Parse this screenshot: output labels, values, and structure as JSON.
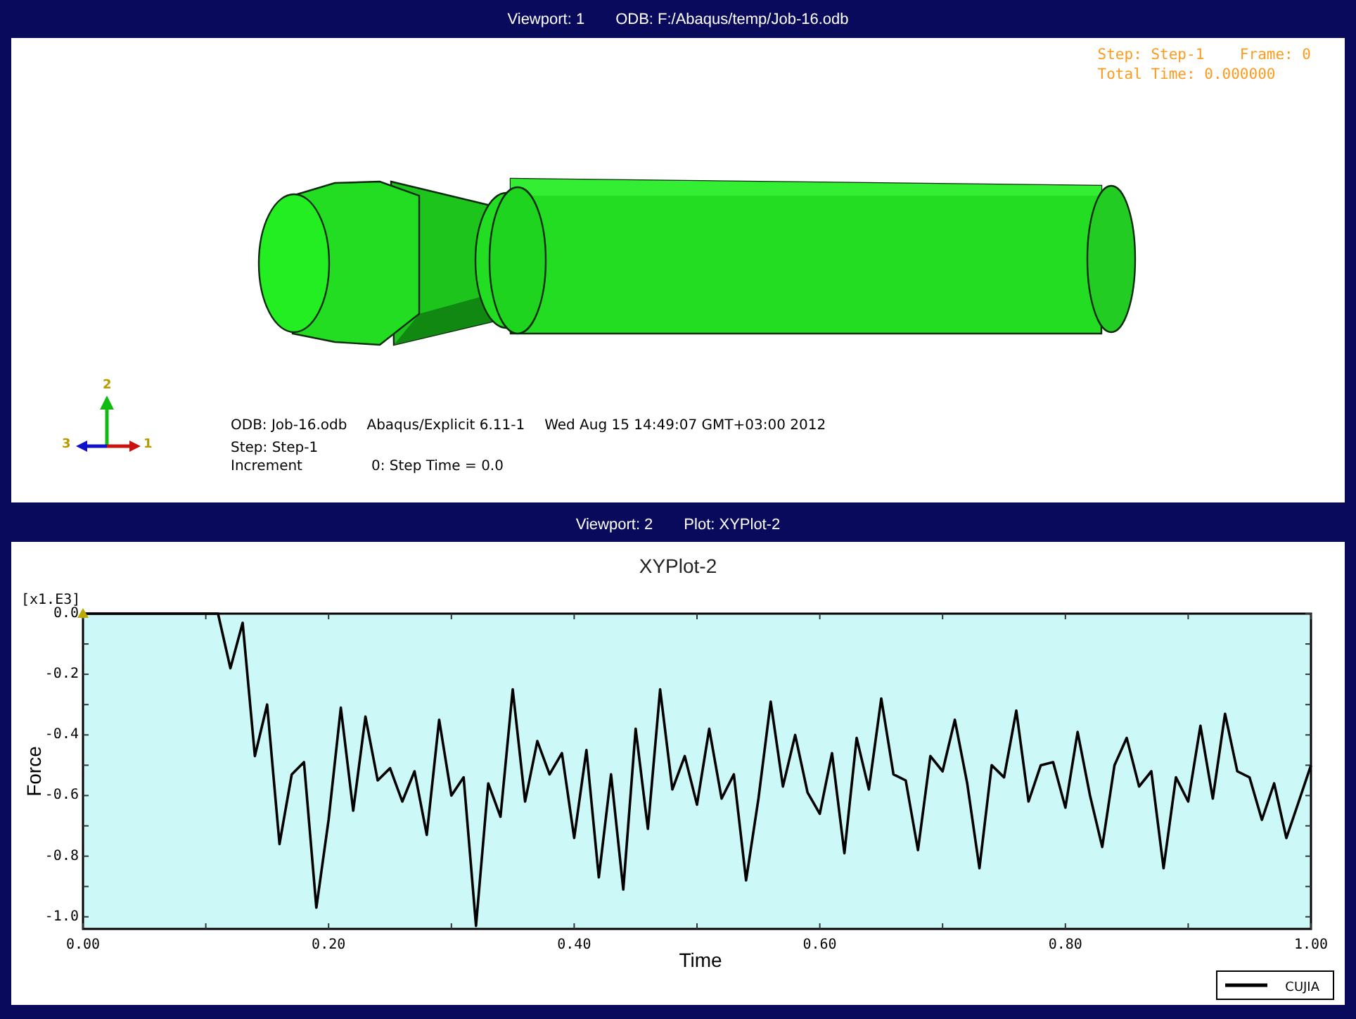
{
  "viewport_1": {
    "title_label": "Viewport: 1",
    "title_odb": "ODB: F:/Abaqus/temp/Job-16.odb",
    "state_lines": [
      "Step: Step-1    Frame: 0",
      "Total Time: 0.000000"
    ],
    "triad": {
      "axis_labels": [
        "1",
        "2",
        "3"
      ]
    },
    "info": {
      "odb": "ODB: Job-16.odb",
      "solver": "Abaqus/Explicit 6.11-1",
      "date": "Wed Aug 15 14:49:07 GMT+03:00 2012",
      "step": "Step: Step-1",
      "increment_label": "Increment",
      "increment_value": "0: Step Time = 0.0"
    }
  },
  "viewport_2": {
    "title_label": "Viewport: 2",
    "title_plot": "Plot: XYPlot-2",
    "y_scale": "[x1.E3]",
    "chart_data": {
      "type": "line",
      "title": "XYPlot-2",
      "xlabel": "Time",
      "ylabel": "Force",
      "x": [
        0,
        0.01,
        0.02,
        0.03,
        0.04,
        0.05,
        0.06,
        0.07,
        0.08,
        0.09,
        0.1,
        0.11,
        0.12,
        0.13,
        0.14,
        0.15,
        0.16,
        0.17,
        0.18,
        0.19,
        0.2,
        0.21,
        0.22,
        0.23,
        0.24,
        0.25,
        0.26,
        0.27,
        0.28,
        0.29,
        0.3,
        0.31,
        0.32,
        0.33,
        0.34,
        0.35,
        0.36,
        0.37,
        0.38,
        0.39,
        0.4,
        0.41,
        0.42,
        0.43,
        0.44,
        0.45,
        0.46,
        0.47,
        0.48,
        0.49,
        0.5,
        0.51,
        0.52,
        0.53,
        0.54,
        0.55,
        0.56,
        0.57,
        0.58,
        0.59,
        0.6,
        0.61,
        0.62,
        0.63,
        0.64,
        0.65,
        0.66,
        0.67,
        0.68,
        0.69,
        0.7,
        0.71,
        0.72,
        0.73,
        0.74,
        0.75,
        0.76,
        0.77,
        0.78,
        0.79,
        0.8,
        0.81,
        0.82,
        0.83,
        0.84,
        0.85,
        0.86,
        0.87,
        0.88,
        0.89,
        0.9,
        0.91,
        0.92,
        0.93,
        0.94,
        0.95,
        0.96,
        0.97,
        0.98,
        0.99,
        1
      ],
      "series": [
        {
          "name": "CUJIA",
          "color": "#000000",
          "values": [
            0,
            0,
            0,
            0,
            0,
            0,
            0,
            0,
            0,
            0,
            0,
            0,
            -0.18,
            -0.03,
            -0.47,
            -0.3,
            -0.76,
            -0.53,
            -0.49,
            -0.97,
            -0.68,
            -0.31,
            -0.65,
            -0.34,
            -0.55,
            -0.51,
            -0.62,
            -0.52,
            -0.73,
            -0.35,
            -0.6,
            -0.54,
            -1.03,
            -0.56,
            -0.67,
            -0.25,
            -0.62,
            -0.42,
            -0.53,
            -0.46,
            -0.74,
            -0.45,
            -0.87,
            -0.53,
            -0.91,
            -0.38,
            -0.71,
            -0.25,
            -0.58,
            -0.47,
            -0.63,
            -0.38,
            -0.61,
            -0.53,
            -0.88,
            -0.61,
            -0.29,
            -0.57,
            -0.4,
            -0.59,
            -0.66,
            -0.46,
            -0.79,
            -0.41,
            -0.58,
            -0.28,
            -0.53,
            -0.55,
            -0.78,
            -0.47,
            -0.52,
            -0.35,
            -0.56,
            -0.84,
            -0.5,
            -0.54,
            -0.32,
            -0.62,
            -0.5,
            -0.49,
            -0.64,
            -0.39,
            -0.6,
            -0.77,
            -0.5,
            -0.41,
            -0.57,
            -0.52,
            -0.84,
            -0.54,
            -0.62,
            -0.37,
            -0.61,
            -0.33,
            -0.52,
            -0.54,
            -0.68,
            -0.56,
            -0.74,
            -0.62,
            -0.5
          ]
        }
      ],
      "xlim": [
        0,
        1
      ],
      "ylim": [
        -1.04,
        0
      ],
      "xticks": [
        {
          "value": 0,
          "label": "0.00"
        },
        {
          "value": 0.2,
          "label": "0.20"
        },
        {
          "value": 0.4,
          "label": "0.40"
        },
        {
          "value": 0.6,
          "label": "0.60"
        },
        {
          "value": 0.8,
          "label": "0.80"
        },
        {
          "value": 1,
          "label": "1.00"
        }
      ],
      "yticks": [
        {
          "value": -1,
          "label": "-1.0"
        },
        {
          "value": -0.8,
          "label": "-0.8"
        },
        {
          "value": -0.6,
          "label": "-0.6"
        },
        {
          "value": -0.4,
          "label": "-0.4"
        },
        {
          "value": -0.2,
          "label": "-0.2"
        },
        {
          "value": 0,
          "label": "0.0"
        }
      ]
    }
  }
}
